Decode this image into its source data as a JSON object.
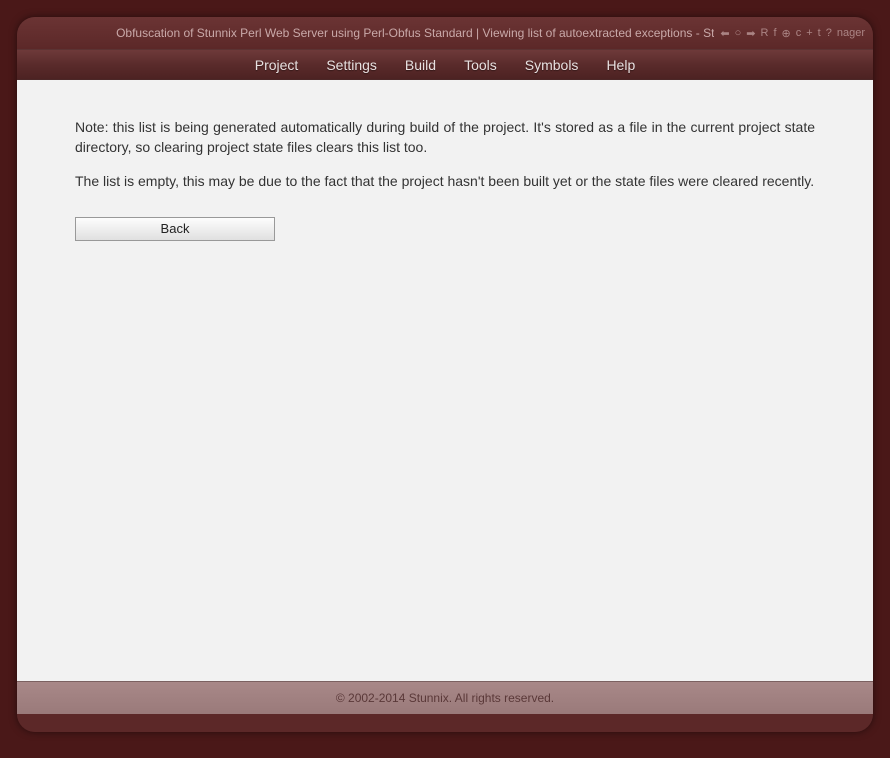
{
  "header": {
    "title": "Obfuscation of Stunnix Perl Web Server using Perl-Obfus Standard | Viewing list of autoextracted exceptions - St",
    "trailing": "nager"
  },
  "toolbar_icons": {
    "back": "⬅",
    "stop": "○",
    "forward": "➡",
    "refresh": "R",
    "f": "f",
    "plus_circle": "⊕",
    "c": "c",
    "plus": "+",
    "t": "t",
    "help": "?"
  },
  "menu": {
    "project": "Project",
    "settings": "Settings",
    "build": "Build",
    "tools": "Tools",
    "symbols": "Symbols",
    "help": "Help"
  },
  "content": {
    "note1": "Note: this list is being generated automatically during build of the project. It's stored as a file in the current project state directory, so clearing project state files clears this list too.",
    "note2": "The list is empty, this may be due to the fact that the project hasn't been built yet or the state files were cleared recently.",
    "back_button": "Back"
  },
  "footer": {
    "copyright": "© 2002-2014 Stunnix. All rights reserved."
  }
}
